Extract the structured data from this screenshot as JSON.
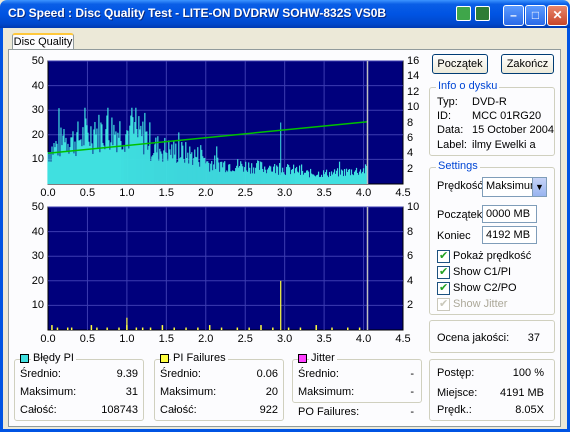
{
  "window": {
    "title": "CD Speed : Disc Quality Test - LITE-ON DVDRW SOHW-832S  VS0B",
    "minimize_glyph": "–",
    "maximize_glyph": "□",
    "close_glyph": "✕"
  },
  "tab": {
    "label": "Disc Quality"
  },
  "buttons": {
    "start": "Początek",
    "finish": "Zakończ"
  },
  "disc_info": {
    "title": "Info o dysku",
    "type_label": "Typ:",
    "type_value": "DVD-R",
    "id_label": "ID:",
    "id_value": "MCC 01RG20",
    "date_label": "Data:",
    "date_value": "15 October 2004",
    "label_label": "Label:",
    "label_value": "ilmy Ewelki a"
  },
  "settings": {
    "title": "Settings",
    "speed_label": "Prędkość",
    "speed_value": "Maksimum",
    "start_label": "Początek",
    "start_value": "0000 MB",
    "end_label": "Koniec",
    "end_value": "4192 MB",
    "show_speed": "Pokaż prędkość",
    "show_c1": "Show C1/PI",
    "show_c2": "Show C2/PO",
    "show_jitter": "Show Jitter"
  },
  "quality": {
    "label": "Ocena jakości:",
    "value": "37"
  },
  "pi_errors": {
    "title": "Błędy PI",
    "color": "#40e0e0",
    "avg_label": "Średnio:",
    "avg": "9.39",
    "max_label": "Maksimum:",
    "max": "31",
    "total_label": "Całość:",
    "total": "108743"
  },
  "pi_failures": {
    "title": "PI Failures",
    "color": "#ffff40",
    "avg_label": "Średnio:",
    "avg": "0.06",
    "max_label": "Maksimum:",
    "max": "20",
    "total_label": "Całość:",
    "total": "922"
  },
  "jitter": {
    "title": "Jitter",
    "color": "#ff40ff",
    "avg_label": "Średnio:",
    "avg": "-",
    "max_label": "Maksimum:",
    "max": "-",
    "po_label": "PO Failures:",
    "po": "-"
  },
  "progress": {
    "progress_label": "Postęp:",
    "progress_value": "100 %",
    "position_label": "Miejsce:",
    "position_value": "4191 MB",
    "speed_label": "Prędk.:",
    "speed_value": "8.05X"
  },
  "chart_data": [
    {
      "type": "bar",
      "series": [
        {
          "name": "PI errors",
          "color": "#40e0e0",
          "max": 31,
          "avg": 9.39
        },
        {
          "name": "Read speed",
          "color": "#00c000",
          "x": [
            0.0,
            4.05
          ],
          "values": [
            4.0,
            8.1
          ]
        }
      ],
      "xlim": [
        0,
        4.5
      ],
      "xticks": [
        "0.0",
        "0.5",
        "1.0",
        "1.5",
        "2.0",
        "2.5",
        "3.0",
        "3.5",
        "4.0",
        "4.5"
      ],
      "ylim_left": [
        0,
        50
      ],
      "yticks_left": [
        "50",
        "40",
        "30",
        "20",
        "10"
      ],
      "ylim_right": [
        0,
        16
      ],
      "yticks_right": [
        "16",
        "14",
        "12",
        "10",
        "8",
        "6",
        "4",
        "2"
      ],
      "end_marker_x": 4.05,
      "grid": true
    },
    {
      "type": "bar",
      "series": [
        {
          "name": "PI failures",
          "color": "#ffff40",
          "max": 20,
          "avg": 0.06
        }
      ],
      "xlim": [
        0,
        4.5
      ],
      "xticks": [
        "0.0",
        "0.5",
        "1.0",
        "1.5",
        "2.0",
        "2.5",
        "3.0",
        "3.5",
        "4.0",
        "4.5"
      ],
      "ylim_left": [
        0,
        50
      ],
      "yticks_left": [
        "50",
        "40",
        "30",
        "20",
        "10"
      ],
      "ylim_right": [
        0,
        10
      ],
      "yticks_right": [
        "10",
        "8",
        "6",
        "4",
        "2"
      ],
      "end_marker_x": 4.05,
      "grid": true
    }
  ]
}
